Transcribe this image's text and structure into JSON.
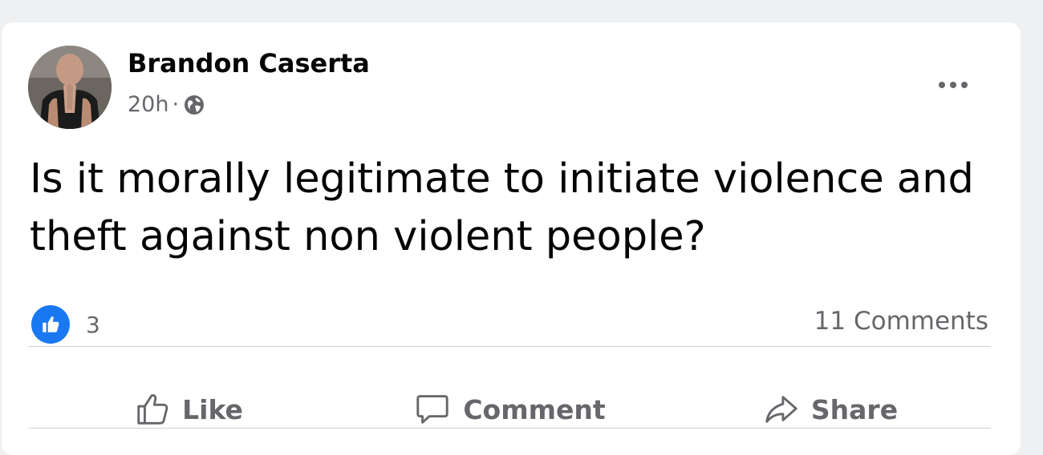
{
  "post": {
    "author": "Brandon Caserta",
    "time": "20h",
    "separator": "·",
    "audience_icon": "globe-icon",
    "text": "Is it morally legitimate to initiate violence and theft against non violent people?",
    "reactions": {
      "icon": "like-reaction-icon",
      "count": "3"
    },
    "comments": "11 Comments"
  },
  "actions": {
    "like": "Like",
    "comment": "Comment",
    "share": "Share"
  },
  "colors": {
    "background": "#eff0f2",
    "card": "#ffffff",
    "text_primary": "#050505",
    "text_secondary": "#65676b",
    "like_blue": "#1a78f2",
    "divider": "#ced0d4"
  }
}
